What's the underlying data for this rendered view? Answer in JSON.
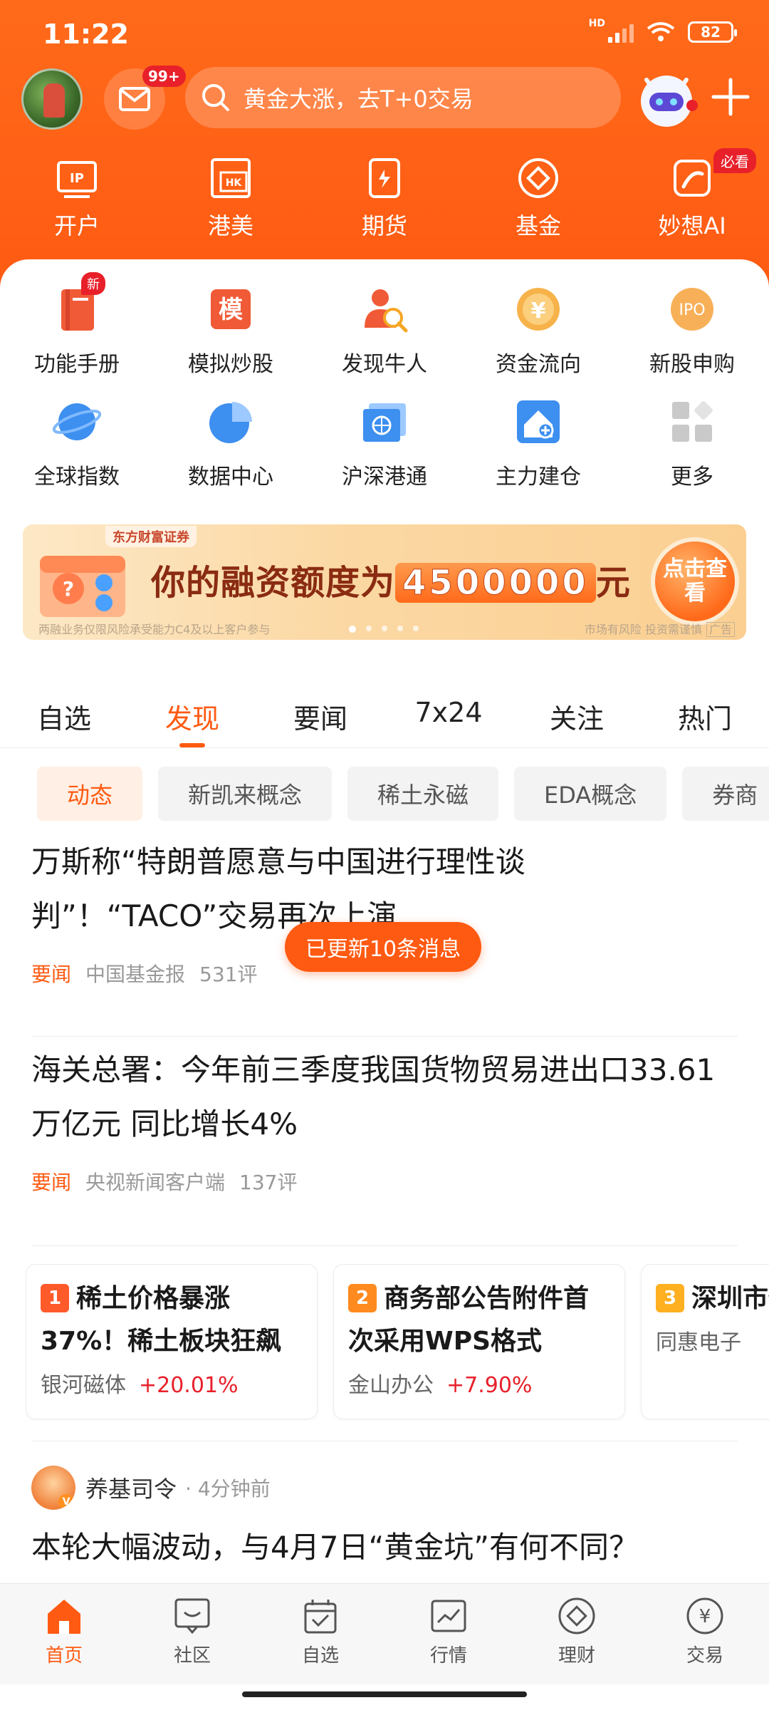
{
  "status": {
    "time": "11:22",
    "net": "HD",
    "battery": "82"
  },
  "header": {
    "mail_badge": "99+",
    "search_text": "黄金大涨，去T+0交易",
    "nav": [
      {
        "label": "开户",
        "icon": "open-account-icon"
      },
      {
        "label": "港美",
        "icon": "hk-us-icon"
      },
      {
        "label": "期货",
        "icon": "futures-icon"
      },
      {
        "label": "基金",
        "icon": "fund-icon"
      },
      {
        "label": "妙想AI",
        "icon": "ai-icon",
        "badge": "必看"
      }
    ]
  },
  "grid": {
    "row1": [
      {
        "label": "功能手册",
        "icon": "manual-icon",
        "badge": "新"
      },
      {
        "label": "模拟炒股",
        "icon": "simulate-icon",
        "icon_text": "模"
      },
      {
        "label": "发现牛人",
        "icon": "discover-expert-icon"
      },
      {
        "label": "资金流向",
        "icon": "capital-flow-icon",
        "icon_text": "¥"
      },
      {
        "label": "新股申购",
        "icon": "ipo-icon",
        "icon_text": "IPO"
      }
    ],
    "row2": [
      {
        "label": "全球指数",
        "icon": "global-index-icon"
      },
      {
        "label": "数据中心",
        "icon": "data-center-icon"
      },
      {
        "label": "沪深港通",
        "icon": "stock-connect-icon"
      },
      {
        "label": "主力建仓",
        "icon": "main-force-icon"
      },
      {
        "label": "更多",
        "icon": "more-icon"
      }
    ]
  },
  "banner": {
    "brand": "东方财富证券",
    "text_before": "你的融资额度为",
    "amount": "4500000",
    "text_after": "元",
    "cta": "点击查看",
    "footnote": "两融业务仅限风险承受能力C4及以上客户参与",
    "risk": "市场有风险 投资需谨慎",
    "ad": "广告"
  },
  "tabs": [
    "自选",
    "发现",
    "要闻",
    "7x24",
    "关注",
    "热门"
  ],
  "active_tab": "发现",
  "chips": [
    "动态",
    "新凯来概念",
    "稀土永磁",
    "EDA概念",
    "券商"
  ],
  "toast": "已更新10条消息",
  "news": [
    {
      "title": "万斯称“特朗普愿意与中国进行理性谈判”！“TACO”交易再次上演",
      "tag": "要闻",
      "source": "中国基金报",
      "comments": "531评"
    },
    {
      "title": "海关总署：今年前三季度我国货物贸易进出口33.61万亿元 同比增长4%",
      "tag": "要闻",
      "source": "央视新闻客户端",
      "comments": "137评"
    }
  ],
  "hot": [
    {
      "rank": "1",
      "title": "稀土价格暴涨37%！稀土板块狂飙",
      "stock": "银河磁体",
      "pct": "+20.01%",
      "color": "#ff5a2a"
    },
    {
      "rank": "2",
      "title": "商务部公告附件首次采用WPS格式",
      "stock": "金山办公",
      "pct": "+7.90%",
      "color": "#ff8a1f"
    },
    {
      "rank": "3",
      "title": "深圳市任：新凯",
      "stock": "同惠电子",
      "pct": "",
      "color": "#ffb020"
    }
  ],
  "post": {
    "author": "养基司令",
    "time": "· 4分钟前",
    "title": "本轮大幅波动，与4月7日“黄金坑”有何不同？"
  },
  "bottom_nav": [
    {
      "label": "首页",
      "icon": "home-icon"
    },
    {
      "label": "社区",
      "icon": "community-icon"
    },
    {
      "label": "自选",
      "icon": "watchlist-icon"
    },
    {
      "label": "行情",
      "icon": "market-icon"
    },
    {
      "label": "理财",
      "icon": "wealth-icon"
    },
    {
      "label": "交易",
      "icon": "trade-icon"
    }
  ],
  "colors": {
    "brand": "#ff5a12",
    "up": "#e8202a"
  }
}
